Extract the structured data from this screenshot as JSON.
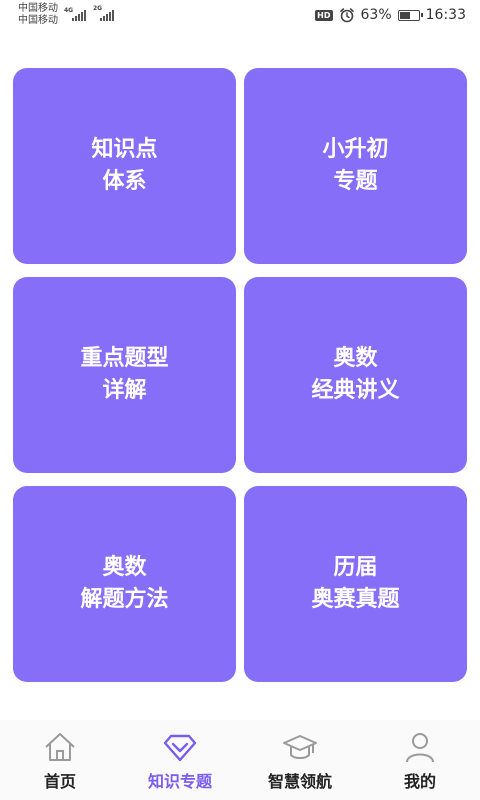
{
  "status_bar": {
    "carrier_1": "中国移动",
    "carrier_2": "中国移动",
    "network_1": "4G",
    "network_2": "2G",
    "hd_badge": "HD",
    "alarm_icon": "alarm-icon",
    "battery_percent": "63%",
    "battery_level": 0.63,
    "time": "16:33"
  },
  "colors": {
    "tile_bg": "#866ef8",
    "active_tab": "#7a5cf0",
    "inactive_tab": "#222222"
  },
  "tiles": [
    {
      "line1": "知识点",
      "line2": "体系"
    },
    {
      "line1": "小升初",
      "line2": "专题"
    },
    {
      "line1": "重点题型",
      "line2": "详解"
    },
    {
      "line1": "奥数",
      "line2": "经典讲义"
    },
    {
      "line1": "奥数",
      "line2": "解题方法"
    },
    {
      "line1": "历届",
      "line2": "奥赛真题"
    }
  ],
  "tab_bar": {
    "tabs": [
      {
        "label": "首页",
        "icon": "home-icon",
        "active": false
      },
      {
        "label": "知识专题",
        "icon": "diamond-icon",
        "active": true
      },
      {
        "label": "智慧领航",
        "icon": "graduation-cap-icon",
        "active": false
      },
      {
        "label": "我的",
        "icon": "user-icon",
        "active": false
      }
    ]
  }
}
